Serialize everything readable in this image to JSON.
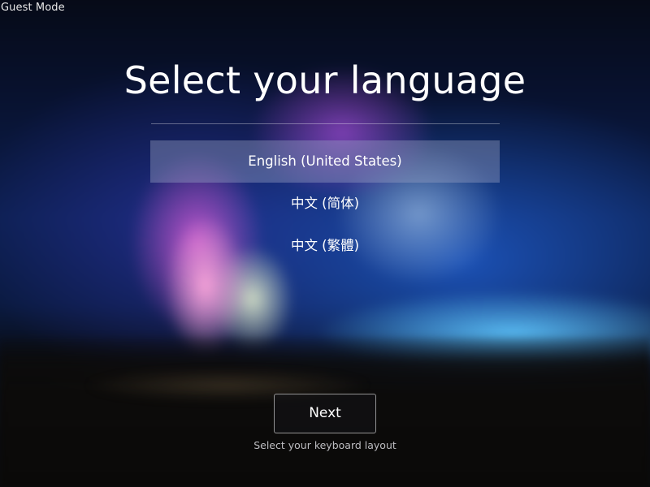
{
  "status": {
    "mode_label": "Guest Mode"
  },
  "setup": {
    "title": "Select your language",
    "languages": [
      {
        "label": "English (United States)",
        "selected": true
      },
      {
        "label": "中文 (简体)",
        "selected": false
      },
      {
        "label": "中文 (繁體)",
        "selected": false
      }
    ],
    "next_label": "Next",
    "keyboard_link": "Select your keyboard layout"
  },
  "colors": {
    "selection_highlight": "#9aa0c3",
    "text": "#ffffff"
  }
}
